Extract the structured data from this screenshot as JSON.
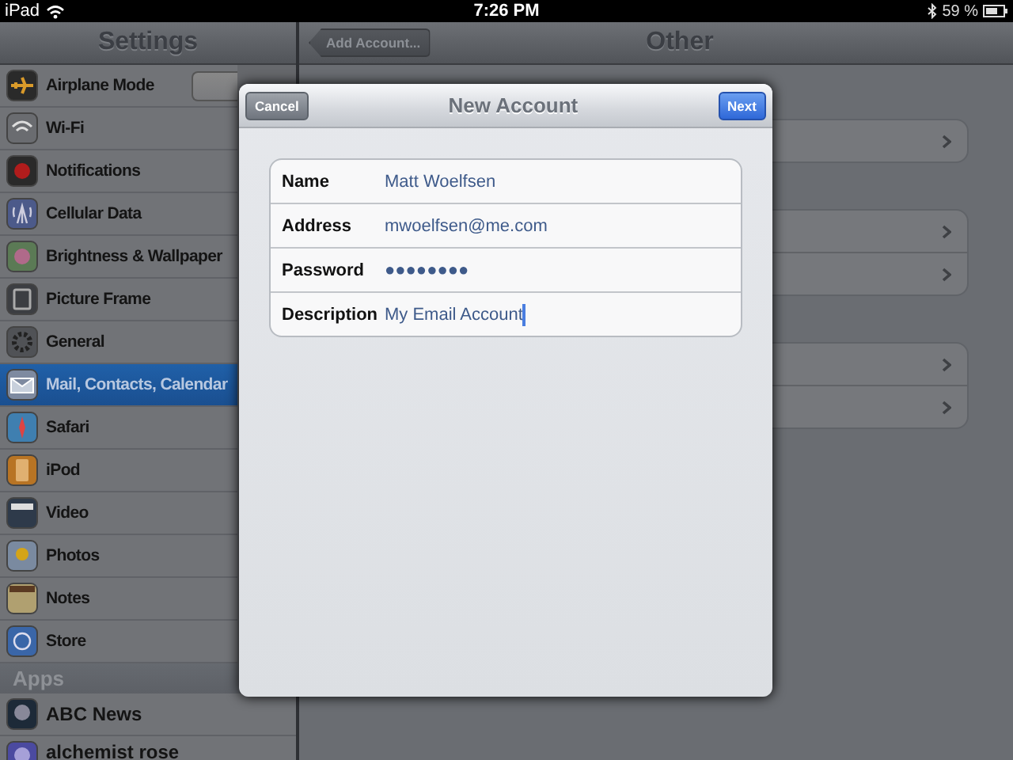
{
  "status_bar": {
    "device": "iPad",
    "time": "7:26 PM",
    "battery": "59 %"
  },
  "sidebar": {
    "title": "Settings",
    "items": [
      {
        "label": "Airplane Mode",
        "selected": false,
        "kind": "toggle",
        "on": false
      },
      {
        "label": "Wi-Fi",
        "selected": false,
        "kind": "link"
      },
      {
        "label": "Notifications",
        "selected": false,
        "kind": "link"
      },
      {
        "label": "Cellular Data",
        "selected": false,
        "kind": "link"
      },
      {
        "label": "Brightness & Wallpaper",
        "selected": false,
        "kind": "link"
      },
      {
        "label": "Picture Frame",
        "selected": false,
        "kind": "link"
      },
      {
        "label": "General",
        "selected": false,
        "kind": "link"
      },
      {
        "label": "Mail, Contacts, Calendar",
        "selected": true,
        "kind": "link"
      },
      {
        "label": "Safari",
        "selected": false,
        "kind": "link"
      },
      {
        "label": "iPod",
        "selected": false,
        "kind": "link"
      },
      {
        "label": "Video",
        "selected": false,
        "kind": "link"
      },
      {
        "label": "Photos",
        "selected": false,
        "kind": "link"
      },
      {
        "label": "Notes",
        "selected": false,
        "kind": "link"
      },
      {
        "label": "Store",
        "selected": false,
        "kind": "link"
      }
    ],
    "section": "Apps",
    "apps": [
      {
        "label": "ABC News",
        "selected": false
      },
      {
        "label": "alchemist rose",
        "selected": false
      }
    ]
  },
  "detail": {
    "back_button": "Add Account...",
    "title": "Other"
  },
  "dialog": {
    "title": "New Account",
    "cancel": "Cancel",
    "next": "Next",
    "fields": [
      {
        "label": "Name",
        "value": "Matt Woelfsen",
        "focused": false
      },
      {
        "label": "Address",
        "value": "mwoelfsen@me.com",
        "focused": false
      },
      {
        "label": "Password",
        "value": "●●●●●●●●",
        "focused": false
      },
      {
        "label": "Description",
        "value": "My Email Account",
        "focused": true
      }
    ]
  }
}
